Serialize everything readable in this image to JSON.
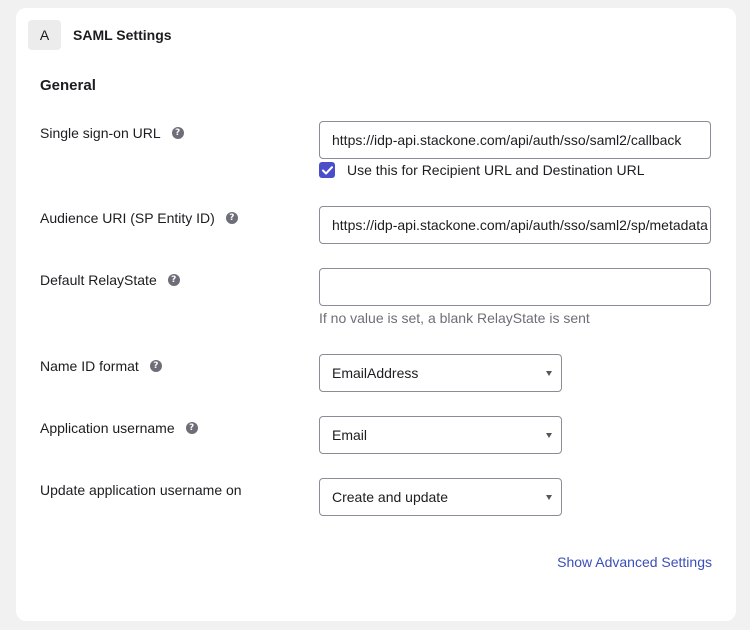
{
  "header": {
    "step": "A",
    "title": "SAML Settings"
  },
  "section": {
    "title": "General"
  },
  "fields": {
    "sso_url": {
      "label": "Single sign-on URL",
      "value": "https://idp-api.stackone.com/api/auth/sso/saml2/callback"
    },
    "recipient_checkbox": {
      "label": "Use this for Recipient URL and Destination URL",
      "checked": true
    },
    "audience_uri": {
      "label": "Audience URI (SP Entity ID)",
      "value": "https://idp-api.stackone.com/api/auth/sso/saml2/sp/metadata"
    },
    "relay_state": {
      "label": "Default RelayState",
      "value": "",
      "hint": "If no value is set, a blank RelayState is sent"
    },
    "name_id_format": {
      "label": "Name ID format",
      "value": "EmailAddress"
    },
    "app_username": {
      "label": "Application username",
      "value": "Email"
    },
    "update_username_on": {
      "label": "Update application username on",
      "value": "Create and update"
    }
  },
  "advanced_link": "Show Advanced Settings",
  "colors": {
    "accent": "#4a4fc9",
    "link": "#3b4fb8",
    "help_icon": "#6e6e78",
    "background": "#f1f1f1"
  },
  "icons": {
    "help": "question-circle-icon",
    "dropdown": "chevron-down-icon",
    "check": "checkmark-icon"
  }
}
